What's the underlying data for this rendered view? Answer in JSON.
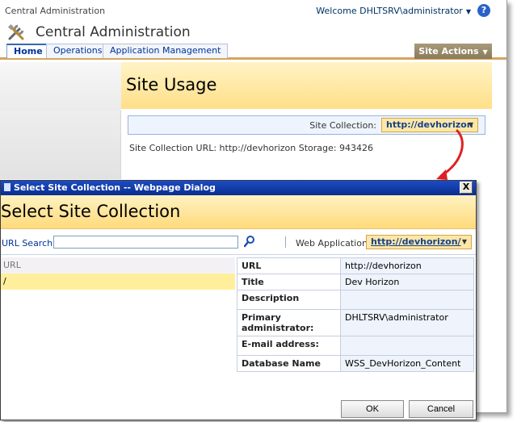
{
  "top_bar": {
    "site_name": "Central Administration",
    "welcome": "Welcome DHLTSRV\\administrator",
    "help_glyph": "?"
  },
  "app_title": "Central Administration",
  "tabs": [
    {
      "label": "Home",
      "active": true
    },
    {
      "label": "Operations",
      "active": false
    },
    {
      "label": "Application Management",
      "active": false
    }
  ],
  "site_actions_label": "Site Actions",
  "page": {
    "title": "Site Usage",
    "site_collection_label": "Site Collection:",
    "site_collection_value": "http://devhorizon",
    "details": "Site Collection URL: http://devhorizon Storage: 943426"
  },
  "dialog": {
    "title": "Select Site Collection -- Webpage Dialog",
    "close_glyph": "X",
    "heading": "Select Site Collection",
    "url_search_label": "URL Search",
    "url_search_value": "",
    "web_app_label": "Web Application:",
    "web_app_value": "http://devhorizon/",
    "list_header": "URL",
    "list_rows": [
      "/"
    ],
    "properties": [
      {
        "label": "URL",
        "value": "http://devhorizon"
      },
      {
        "label": "Title",
        "value": "Dev Horizon"
      },
      {
        "label": "Description",
        "value": ""
      },
      {
        "label": "Primary administrator:",
        "value": "DHLTSRV\\administrator"
      },
      {
        "label": "E-mail address:",
        "value": ""
      },
      {
        "label": "Database Name",
        "value": "WSS_DevHorizon_Content"
      }
    ],
    "ok_label": "OK",
    "cancel_label": "Cancel"
  },
  "colors": {
    "banner": "#ffdf88",
    "accent_blue": "#003399",
    "dialog_title": "#0a2d8e",
    "callout_arrow": "#e02020"
  }
}
